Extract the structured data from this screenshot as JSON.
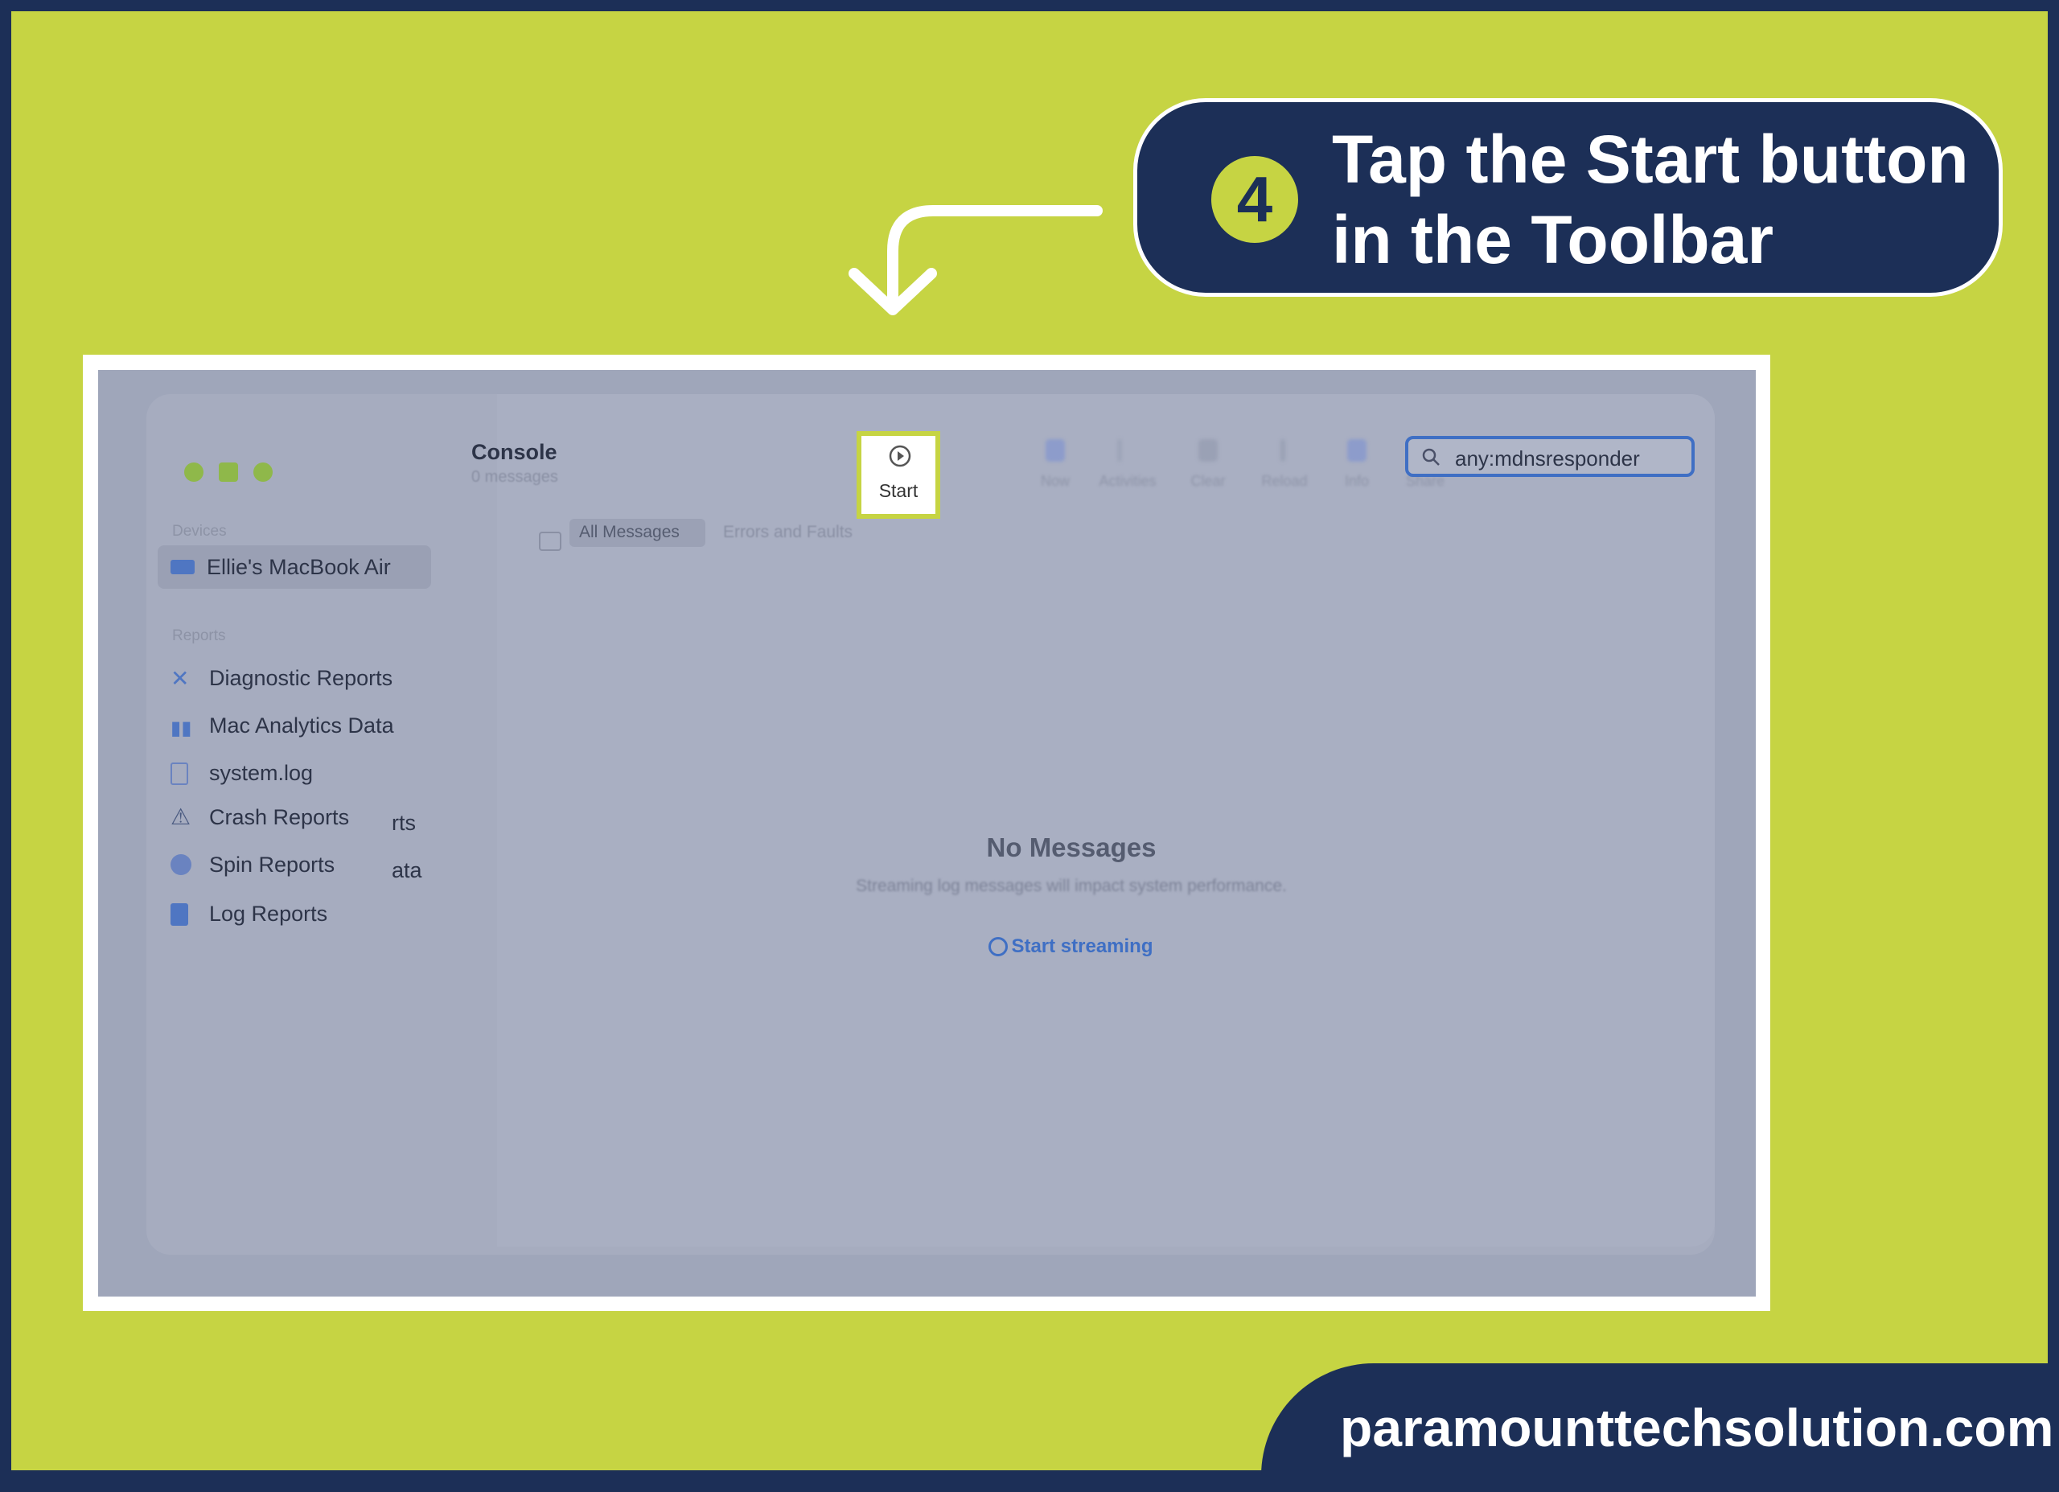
{
  "callout": {
    "step": "4",
    "line1": "Tap the Start button",
    "line2": "in the Toolbar"
  },
  "console": {
    "title": "Console",
    "subtitle": "0 messages",
    "toolbar": [
      {
        "label": "Start",
        "icon": "play-circle-icon"
      },
      {
        "label": "Now"
      },
      {
        "label": "Activities"
      },
      {
        "label": "Clear"
      },
      {
        "label": "Reload"
      },
      {
        "label": "Info"
      },
      {
        "label": "Share"
      }
    ],
    "search": {
      "value": "any:mdnsresponder",
      "icon": "search-icon"
    },
    "tabs": [
      "All Messages",
      "Errors and Faults"
    ],
    "sidebar": {
      "devices_header": "Devices",
      "device": "Ellie's MacBook Air",
      "reports_header": "Reports",
      "items": [
        {
          "label": "Diagnostic Reports",
          "icon": "tools-icon"
        },
        {
          "label": "Mac Analytics Data",
          "icon": "bar-chart-icon"
        },
        {
          "label": "system.log",
          "icon": "document-icon"
        },
        {
          "label": "Crash Reports",
          "icon": "warning-icon"
        },
        {
          "label": "Spin Reports",
          "icon": "spin-icon"
        },
        {
          "label": "Log Reports",
          "icon": "log-icon"
        }
      ],
      "overlap_fragments": [
        "rts",
        "ata"
      ]
    },
    "empty": {
      "title": "No Messages",
      "text": "Streaming log messages will impact system performance.",
      "action": "Start streaming"
    }
  },
  "footer": "paramounttechsolution.com",
  "colors": {
    "background": "#c6d443",
    "navy": "#1c2f57",
    "accent": "#3f6fc4"
  }
}
